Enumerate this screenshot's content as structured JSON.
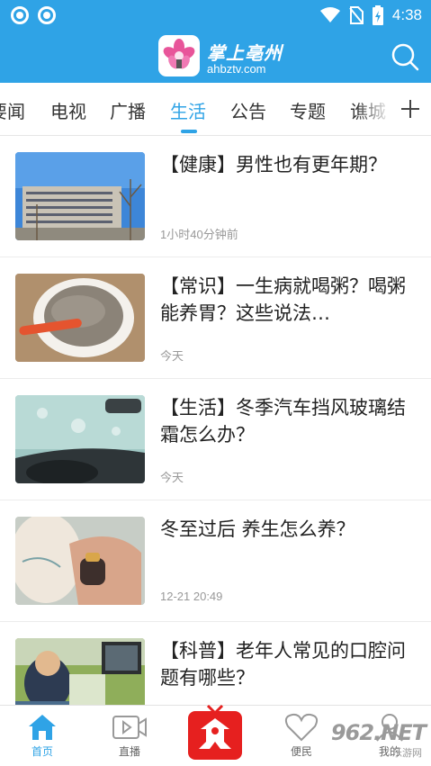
{
  "status_bar": {
    "time": "4:38",
    "battery_level": "4"
  },
  "header": {
    "title": "掌上亳州",
    "url": "ahbztv.com"
  },
  "tabs": [
    {
      "label": "要闻"
    },
    {
      "label": "电视"
    },
    {
      "label": "广播"
    },
    {
      "label": "生活",
      "active": true
    },
    {
      "label": "公告"
    },
    {
      "label": "专题"
    },
    {
      "label": "谯城"
    }
  ],
  "news": [
    {
      "title": "【健康】男性也有更年期？",
      "time": "1小时40分钟前"
    },
    {
      "title": "【常识】一生病就喝粥？喝粥能养胃？这些说法…",
      "time": "今天"
    },
    {
      "title": "【生活】冬季汽车挡风玻璃结霜怎么办？",
      "time": "今天"
    },
    {
      "title": "冬至过后  养生怎么养？",
      "time": "12-21 20:49"
    },
    {
      "title": "【科普】老年人常见的口腔问题有哪些？",
      "time": ""
    }
  ],
  "bottom_nav": {
    "home": "首页",
    "live": "直播",
    "convenience": "便民",
    "mine": "我的"
  },
  "watermark": {
    "brand": "962.NET",
    "sub": "乐游网"
  },
  "colors": {
    "accent": "#2fa3e6",
    "center_red": "#e6201f"
  },
  "icons": [
    "search-icon",
    "plus-icon",
    "home-icon",
    "live-play-icon",
    "tv-logo-icon",
    "heart-icon"
  ]
}
